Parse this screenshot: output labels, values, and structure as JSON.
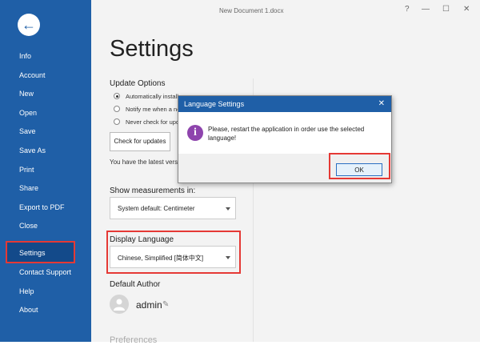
{
  "window": {
    "title": "New Document 1.docx",
    "controls": [
      "?",
      "—",
      "☐",
      "✕"
    ]
  },
  "sidebar": {
    "back_glyph": "←",
    "items": [
      {
        "label": "Info"
      },
      {
        "label": "Account"
      },
      {
        "label": "New"
      },
      {
        "label": "Open"
      },
      {
        "label": "Save"
      },
      {
        "label": "Save As"
      },
      {
        "label": "Print"
      },
      {
        "label": "Share"
      },
      {
        "label": "Export to PDF"
      },
      {
        "label": "Close"
      },
      {
        "label": "Settings",
        "active": true
      },
      {
        "label": "Contact Support"
      },
      {
        "label": "Help"
      },
      {
        "label": "About"
      }
    ]
  },
  "settings": {
    "title": "Settings",
    "update_options": {
      "label": "Update Options",
      "options": [
        {
          "label": "Automatically install",
          "checked": true
        },
        {
          "label": "Notify me when a ne",
          "checked": false
        },
        {
          "label": "Never check for upda",
          "checked": false
        }
      ],
      "check_button": "Check for updates",
      "status": "You have the latest versi"
    },
    "measurements": {
      "label": "Show measurements in:",
      "value": "System default: Centimeter"
    },
    "display_language": {
      "label": "Display Language",
      "value": "Chinese, Simplified [简体中文]"
    },
    "default_author": {
      "label": "Default Author",
      "name": "admin"
    },
    "preferences_label": "Preferences"
  },
  "dialog": {
    "title": "Language Settings",
    "message": "Please, restart the application in order use the selected language!",
    "ok_label": "OK",
    "close_glyph": "✕",
    "info_glyph": "i"
  },
  "colors": {
    "sidebar": "#1f5fa7",
    "highlight": "#e53935",
    "info_icon": "#8e44ad"
  }
}
